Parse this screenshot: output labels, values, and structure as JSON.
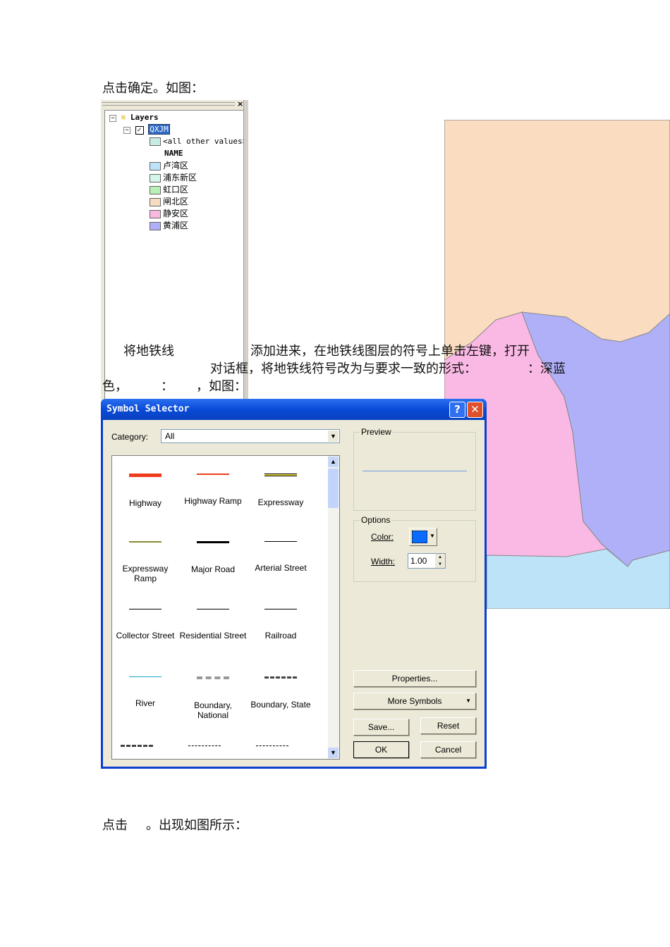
{
  "doc": {
    "line_intro": "点击确定。如图：",
    "para1_a": "将地铁线",
    "para1_b": "添加进来，在地铁线图层的符号上单击左键，打开",
    "para2_a": "对话框，将地铁线符号改为与要求一致的形式：",
    "para2_b": "：深蓝",
    "para3_a": "色，",
    "para3_b": "：",
    "para3_c": "，如图：",
    "footer_a": "点击",
    "footer_b": "。出现如图所示："
  },
  "layers": {
    "root": "Layers",
    "layer": "QXJM",
    "other": "<all other values>",
    "field": "NAME",
    "items": [
      {
        "label": "卢湾区",
        "color": "#bde3f8"
      },
      {
        "label": "浦东新区",
        "color": "#d6f5ea"
      },
      {
        "label": "虹口区",
        "color": "#b8f0b8"
      },
      {
        "label": "闸北区",
        "color": "#f8dcc0"
      },
      {
        "label": "静安区",
        "color": "#f8b8e0"
      },
      {
        "label": "黄浦区",
        "color": "#b0b0f8"
      }
    ],
    "other_color": "#c8ece4"
  },
  "map": {
    "colors": {
      "peach": "#fadcc0",
      "pink": "#fab8e4",
      "blue": "#b0b0f8",
      "lightblue": "#bde3f8"
    }
  },
  "dialog": {
    "title": "Symbol Selector",
    "category_label": "Category:",
    "category_value": "All",
    "preview_label": "Preview",
    "options_label": "Options",
    "color_label": "Color:",
    "color_value": "#0a6cff",
    "width_label": "Width:",
    "width_value": "1.00",
    "properties": "Properties...",
    "more_symbols": "More Symbols",
    "save": "Save...",
    "reset": "Reset",
    "ok": "OK",
    "cancel": "Cancel",
    "symbols": [
      {
        "label": "Highway"
      },
      {
        "label": "Highway Ramp"
      },
      {
        "label": "Expressway"
      },
      {
        "label": "Expressway Ramp"
      },
      {
        "label": "Major Road"
      },
      {
        "label": "Arterial Street"
      },
      {
        "label": "Collector Street"
      },
      {
        "label": "Residential Street"
      },
      {
        "label": "Railroad"
      },
      {
        "label": "River"
      },
      {
        "label": "Boundary, National"
      },
      {
        "label": "Boundary, State"
      }
    ]
  }
}
